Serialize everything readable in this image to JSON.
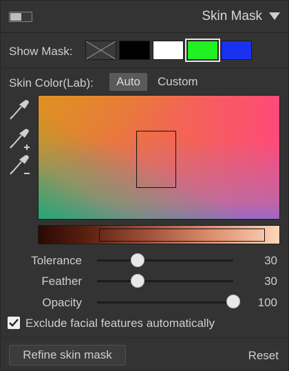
{
  "header": {
    "title": "Skin Mask",
    "toggle_state": "on"
  },
  "show_mask": {
    "label": "Show Mask:",
    "options": [
      {
        "name": "none",
        "color": "#333333"
      },
      {
        "name": "black",
        "color": "#000000"
      },
      {
        "name": "white",
        "color": "#ffffff"
      },
      {
        "name": "green",
        "color": "#22f022",
        "selected": true
      },
      {
        "name": "blue",
        "color": "#1a32f0"
      }
    ]
  },
  "skin_color": {
    "label": "Skin Color(Lab):",
    "modes": [
      "Auto",
      "Custom"
    ],
    "active_mode": "Auto"
  },
  "tools": [
    "eyedropper-icon",
    "eyedropper-add-icon",
    "eyedropper-subtract-icon"
  ],
  "sliders": [
    {
      "label": "Tolerance",
      "value": "30",
      "fraction": 0.3
    },
    {
      "label": "Feather",
      "value": "30",
      "fraction": 0.3
    },
    {
      "label": "Opacity",
      "value": "100",
      "fraction": 1.0
    }
  ],
  "checkbox": {
    "label": "Exclude facial features automatically",
    "checked": true
  },
  "footer": {
    "refine_label": "Refine skin mask",
    "reset_label": "Reset"
  },
  "colors": {
    "panel": "#333333",
    "text": "#cfcfcf",
    "selected_outline": "#e6e6e6"
  }
}
